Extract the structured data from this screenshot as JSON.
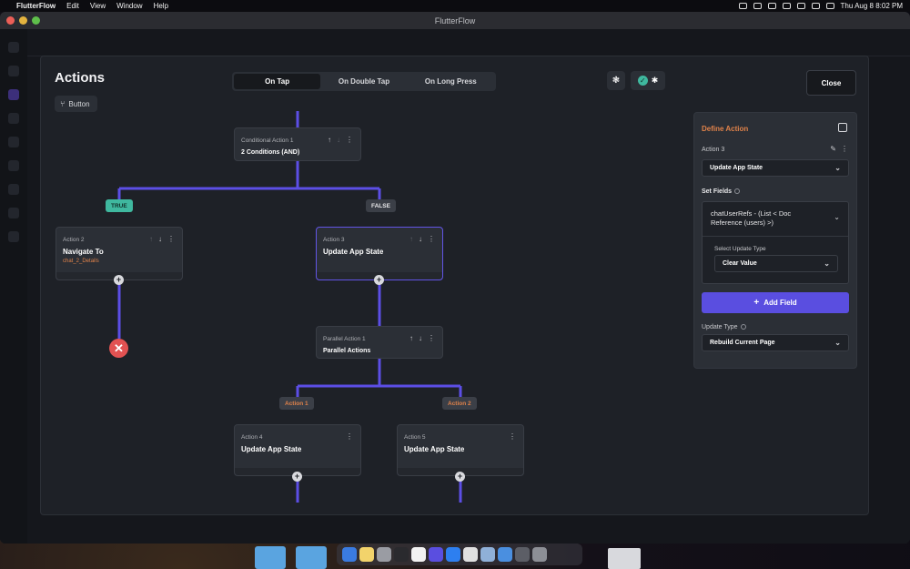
{
  "menubar": {
    "app": "FlutterFlow",
    "items": [
      "Edit",
      "View",
      "Window",
      "Help"
    ],
    "clock": "Thu Aug 8  8:02 PM"
  },
  "window": {
    "title": "FlutterFlow"
  },
  "modal": {
    "title": "Actions",
    "source_widget": "Button",
    "tabs": [
      "On Tap",
      "On Double Tap",
      "On Long Press"
    ],
    "active_tab": "On Tap",
    "close_label": "Close"
  },
  "flow": {
    "conditional": {
      "title": "Conditional Action 1",
      "subtitle": "2 Conditions (AND)"
    },
    "true_label": "TRUE",
    "false_label": "FALSE",
    "action2": {
      "title": "Action 2",
      "subtitle": "Navigate To",
      "detail": "chat_2_Details"
    },
    "action3": {
      "title": "Action 3",
      "subtitle": "Update App State"
    },
    "parallel": {
      "title": "Parallel Action 1",
      "subtitle": "Parallel Actions"
    },
    "branch1_label": "Action 1",
    "branch2_label": "Action 2",
    "action4": {
      "title": "Action 4",
      "subtitle": "Update App State"
    },
    "action5": {
      "title": "Action 5",
      "subtitle": "Update App State"
    },
    "plus": "+",
    "end": "✕",
    "up": "↑",
    "down": "↓",
    "more": "⋮"
  },
  "panel": {
    "title": "Define Action",
    "action_name": "Action 3",
    "action_type": "Update App State",
    "set_fields_label": "Set Fields",
    "field_name": "chatUserRefs - (List < Doc Reference (users) >)",
    "update_type_sub_label": "Select Update Type",
    "update_type_value": "Clear Value",
    "add_field_label": "Add Field",
    "update_type_label": "Update Type",
    "update_type_select": "Rebuild Current Page"
  },
  "colors": {
    "accent": "#5a4ee0",
    "line": "#5c4ee6",
    "true_badge": "#3fb89f",
    "orange": "#e0824a",
    "danger": "#e25252"
  }
}
